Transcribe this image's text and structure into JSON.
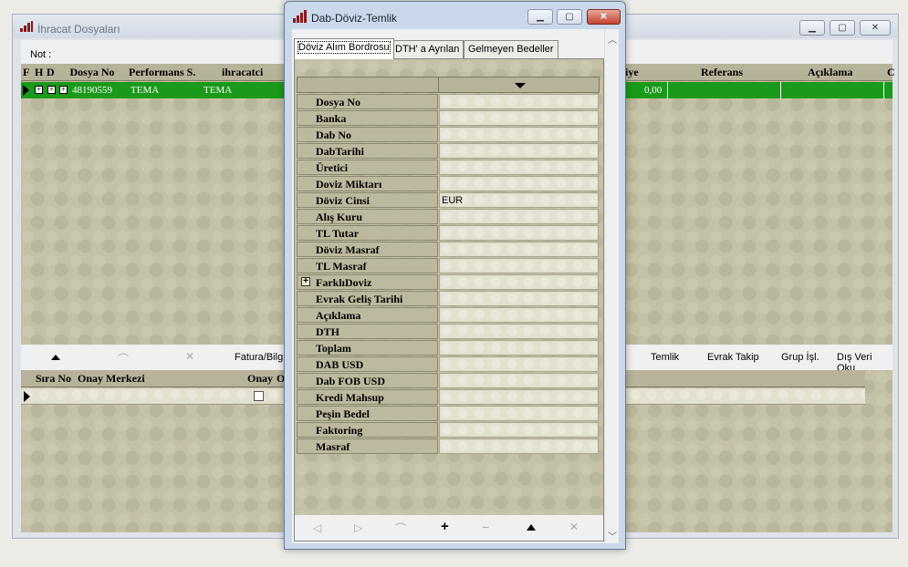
{
  "bg_window": {
    "title": "İhracat Dosyaları",
    "note_label": "Not :",
    "headers": [
      "F",
      "H",
      "D",
      "Dosya No",
      "Performans S.",
      "ihracatci",
      "iye",
      "Referans",
      "Açıklama",
      "C"
    ],
    "selected_row": {
      "dosya_no": "48190559",
      "performans": "TEMA",
      "ihracatci": "TEMA",
      "amount": "0,00"
    },
    "toolbar": [
      "Fatura/Bilgi",
      "Temlik",
      "Evrak Takip",
      "Grup İşl.",
      "Dış Veri Oku"
    ],
    "lower_headers": [
      "Sıra No",
      "Onay Merkezi",
      "Onay",
      "O"
    ]
  },
  "dialog": {
    "title": "Dab-Döviz-Temlik",
    "tabs": [
      "Döviz Alım Bordrosu",
      "DTH' a Ayrılan",
      "Gelmeyen Bedeller"
    ],
    "fields": [
      {
        "label": "Dosya No",
        "value": ""
      },
      {
        "label": "Banka",
        "value": ""
      },
      {
        "label": "Dab No",
        "value": ""
      },
      {
        "label": "DabTarihi",
        "value": ""
      },
      {
        "label": "Üretici",
        "value": ""
      },
      {
        "label": "Doviz Miktarı",
        "value": ""
      },
      {
        "label": "Döviz Cinsi",
        "value": "EUR"
      },
      {
        "label": "Alış Kuru",
        "value": ""
      },
      {
        "label": "TL Tutar",
        "value": ""
      },
      {
        "label": "Döviz Masraf",
        "value": ""
      },
      {
        "label": "TL Masraf",
        "value": ""
      },
      {
        "label": "FarklıDoviz",
        "value": ""
      },
      {
        "label": "Evrak Geliş Tarihi",
        "value": ""
      },
      {
        "label": "Açıklama",
        "value": ""
      },
      {
        "label": "DTH",
        "value": ""
      },
      {
        "label": "Toplam",
        "value": ""
      },
      {
        "label": "DAB USD",
        "value": ""
      },
      {
        "label": "Dab FOB USD",
        "value": ""
      },
      {
        "label": "Kredi Mahsup",
        "value": ""
      },
      {
        "label": "Peşin Bedel",
        "value": ""
      },
      {
        "label": "Faktoring",
        "value": ""
      },
      {
        "label": "Masraf",
        "value": ""
      }
    ]
  }
}
